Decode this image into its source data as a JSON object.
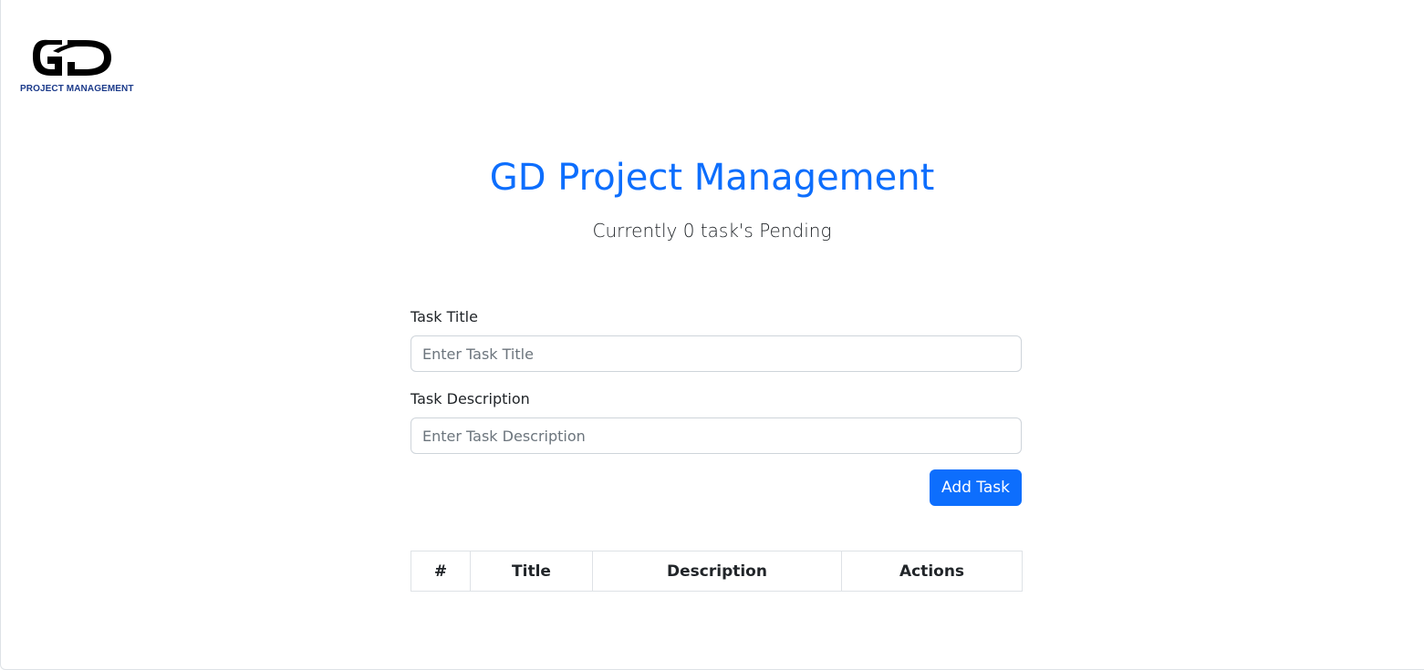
{
  "logo": {
    "caption": "PROJECT MANAGEMENT"
  },
  "header": {
    "title": "GD Project Management",
    "subtitle": "Currently 0 task's Pending"
  },
  "form": {
    "title_label": "Task Title",
    "title_placeholder": "Enter Task Title",
    "title_value": "",
    "description_label": "Task Description",
    "description_placeholder": "Enter Task Description",
    "description_value": "",
    "submit_label": "Add Task"
  },
  "table": {
    "columns": [
      "#",
      "Title",
      "Description",
      "Actions"
    ],
    "rows": []
  },
  "colors": {
    "accent": "#0d6efd",
    "logo_caption": "#1b3a8a"
  }
}
